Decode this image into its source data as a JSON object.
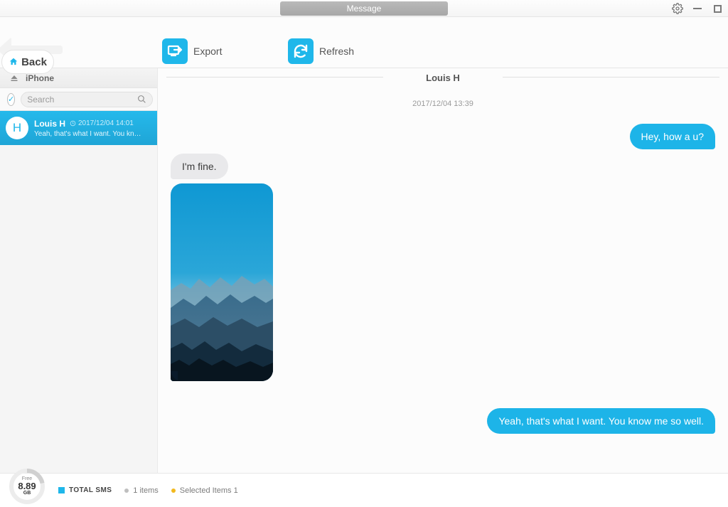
{
  "window": {
    "title": "Message"
  },
  "toolbar": {
    "back_label": "Back",
    "export_label": "Export",
    "refresh_label": "Refresh"
  },
  "sidebar": {
    "device_name": "iPhone",
    "search_placeholder": "Search",
    "threads": [
      {
        "avatar_initial": "H",
        "name": "Louis H",
        "time": "2017/12/04 14:01",
        "preview": "Yeah, that's what I want. You kn…"
      }
    ]
  },
  "conversation": {
    "contact_name": "Louis H",
    "date_separator": "2017/12/04 13:39",
    "messages": [
      {
        "dir": "out",
        "type": "text",
        "text": "Hey, how a u?"
      },
      {
        "dir": "in",
        "type": "text",
        "text": "I'm fine."
      },
      {
        "dir": "in",
        "type": "image",
        "alt": "mountain-landscape-image"
      },
      {
        "dir": "out",
        "type": "text",
        "text": "Yeah, that's what I want. You know me so well."
      }
    ]
  },
  "footer": {
    "storage": {
      "free_label": "Free",
      "free_value": "8.89",
      "free_unit": "GB"
    },
    "total_label": "TOTAL SMS",
    "items_text": "1 items",
    "selected_text": "Selected Items 1"
  }
}
